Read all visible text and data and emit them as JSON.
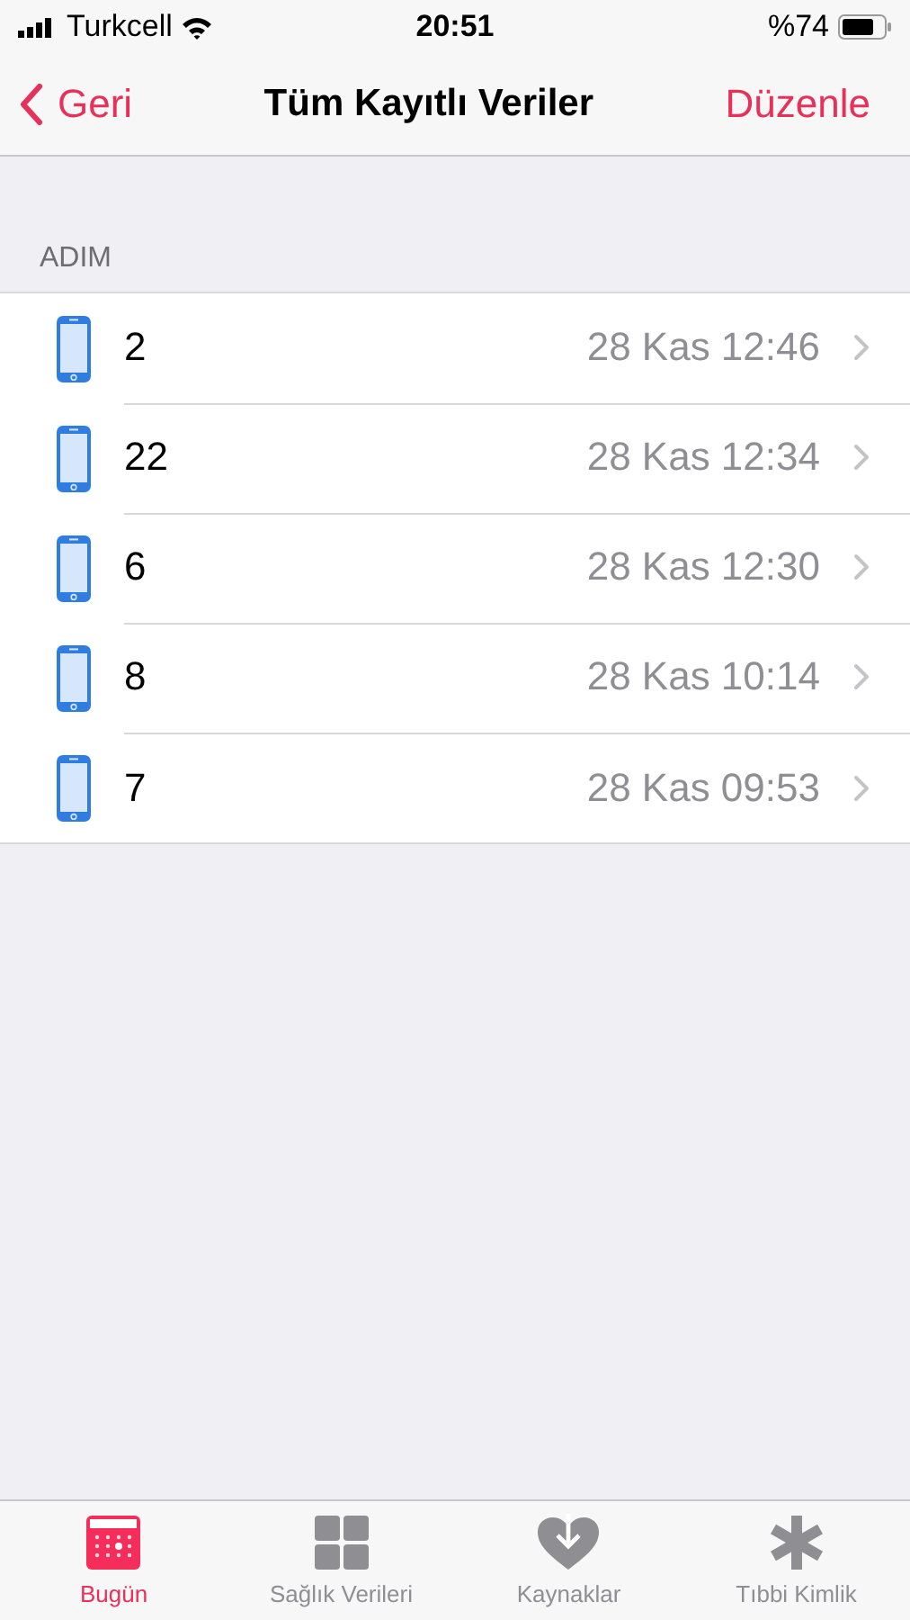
{
  "status_bar": {
    "carrier": "Turkcell",
    "time": "20:51",
    "battery": "%74"
  },
  "nav": {
    "back": "Geri",
    "title": "Tüm Kayıtlı Veriler",
    "action": "Düzenle"
  },
  "section": {
    "header": "ADIM",
    "rows": [
      {
        "value": "2",
        "date": "28 Kas 12:46"
      },
      {
        "value": "22",
        "date": "28 Kas 12:34"
      },
      {
        "value": "6",
        "date": "28 Kas 12:30"
      },
      {
        "value": "8",
        "date": "28 Kas 10:14"
      },
      {
        "value": "7",
        "date": "28 Kas 09:53"
      }
    ]
  },
  "tabs": [
    {
      "label": "Bugün",
      "kind": "calendar",
      "selected": true
    },
    {
      "label": "Sağlık Verileri",
      "kind": "grid",
      "selected": false
    },
    {
      "label": "Kaynaklar",
      "kind": "heart",
      "selected": false
    },
    {
      "label": "Tıbbi Kimlik",
      "kind": "asterisk",
      "selected": false
    }
  ]
}
